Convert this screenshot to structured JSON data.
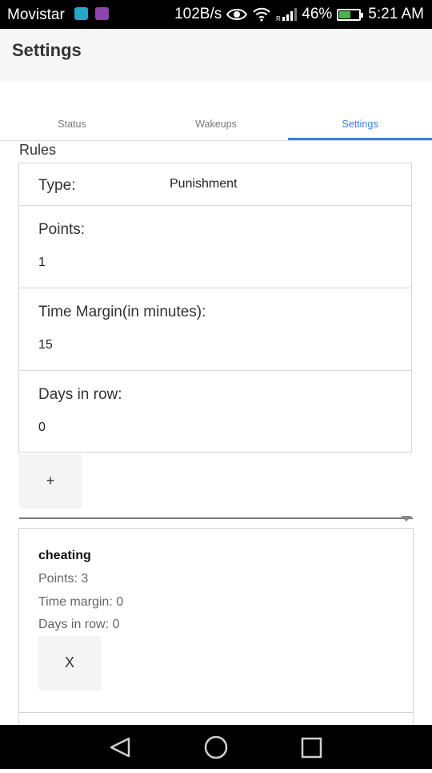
{
  "statusbar": {
    "carrier": "Movistar",
    "net_speed": "102B/s",
    "battery": "46%",
    "time": "5:21 AM",
    "colors": {
      "app_icon_1": "#26a6c9",
      "app_icon_2": "#8e44ad"
    }
  },
  "appbar": {
    "title": "Settings"
  },
  "tabs": [
    {
      "label": "Status",
      "active": false
    },
    {
      "label": "Wakeups",
      "active": false
    },
    {
      "label": "Settings",
      "active": true
    }
  ],
  "accent_color": "#3b7fd9",
  "rules": {
    "section_title": "Rules",
    "type_label": "Type:",
    "type_value": "Punishment",
    "points_label": "Points:",
    "points_value": "1",
    "margin_label": "Time Margin(in minutes):",
    "margin_value": "15",
    "days_label": "Days in row:",
    "days_value": "0",
    "add_label": "+"
  },
  "rule_list": [
    {
      "name": "cheating",
      "points": "Points: 3",
      "margin": "Time margin: 0",
      "days": "Days in row: 0",
      "remove_label": "X"
    }
  ],
  "navbar": {
    "icons": [
      "back-icon",
      "home-icon",
      "recents-icon"
    ]
  }
}
